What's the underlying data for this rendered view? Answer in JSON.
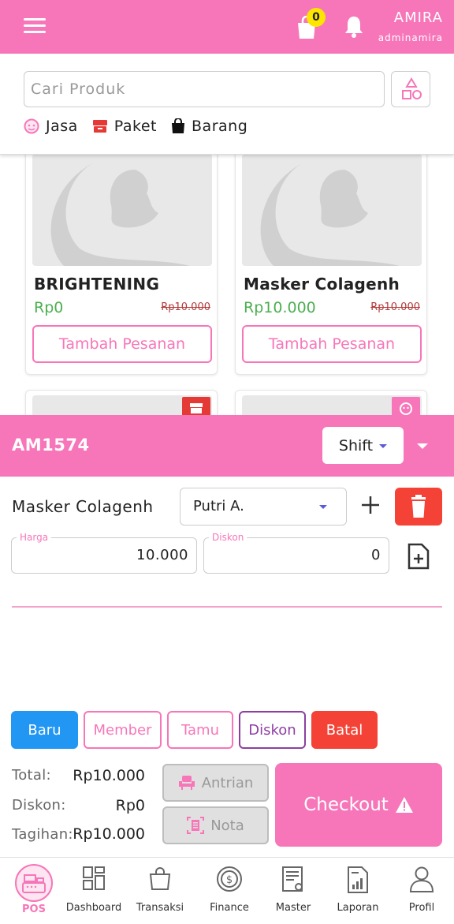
{
  "header": {
    "cart_count": "0",
    "user_name": "AMIRA",
    "user_handle": "adminamira"
  },
  "search": {
    "placeholder": "Cari Produk",
    "categories": [
      {
        "label": "Jasa",
        "icon": "face-icon"
      },
      {
        "label": "Paket",
        "icon": "package-icon"
      },
      {
        "label": "Barang",
        "icon": "shopping-bag-icon"
      }
    ]
  },
  "products": [
    {
      "name": "BRIGHTENING",
      "price": "Rp0",
      "old_price": "Rp10.000",
      "button": "Tambah Pesanan"
    },
    {
      "name": "Masker Colagenh",
      "price": "Rp10.000",
      "old_price": "Rp10.000",
      "button": "Tambah Pesanan"
    }
  ],
  "order": {
    "id": "AM1574",
    "shift_label": "Shift",
    "item": {
      "name": "Masker Colagenh",
      "staff": "Putri A.",
      "harga_label": "Harga",
      "harga_value": "10.000",
      "diskon_label": "Diskon",
      "diskon_value": "0"
    }
  },
  "actions": {
    "baru": "Baru",
    "member": "Member",
    "tamu": "Tamu",
    "diskon": "Diskon",
    "batal": "Batal"
  },
  "totals": {
    "total_label": "Total:",
    "total_value": "Rp10.000",
    "diskon_label": "Diskon:",
    "diskon_value": "Rp0",
    "tagihan_label": "Tagihan:",
    "tagihan_value": "Rp10.000"
  },
  "buttons": {
    "antrian": "Antrian",
    "nota": "Nota",
    "checkout": "Checkout"
  },
  "nav": [
    {
      "label": "POS",
      "icon": "cash-register-icon",
      "active": true
    },
    {
      "label": "Dashboard",
      "icon": "dashboard-icon"
    },
    {
      "label": "Transaksi",
      "icon": "shopping-bag-icon"
    },
    {
      "label": "Finance",
      "icon": "dollar-coin-icon"
    },
    {
      "label": "Master",
      "icon": "document-gear-icon"
    },
    {
      "label": "Laporan",
      "icon": "report-icon"
    },
    {
      "label": "Profil",
      "icon": "user-icon"
    }
  ],
  "colors": {
    "primary": "#f776b9",
    "price_green": "#4caf50",
    "danger": "#f44336",
    "info": "#2196f3",
    "purple": "#8e3ea2",
    "badge": "#ffe600"
  }
}
